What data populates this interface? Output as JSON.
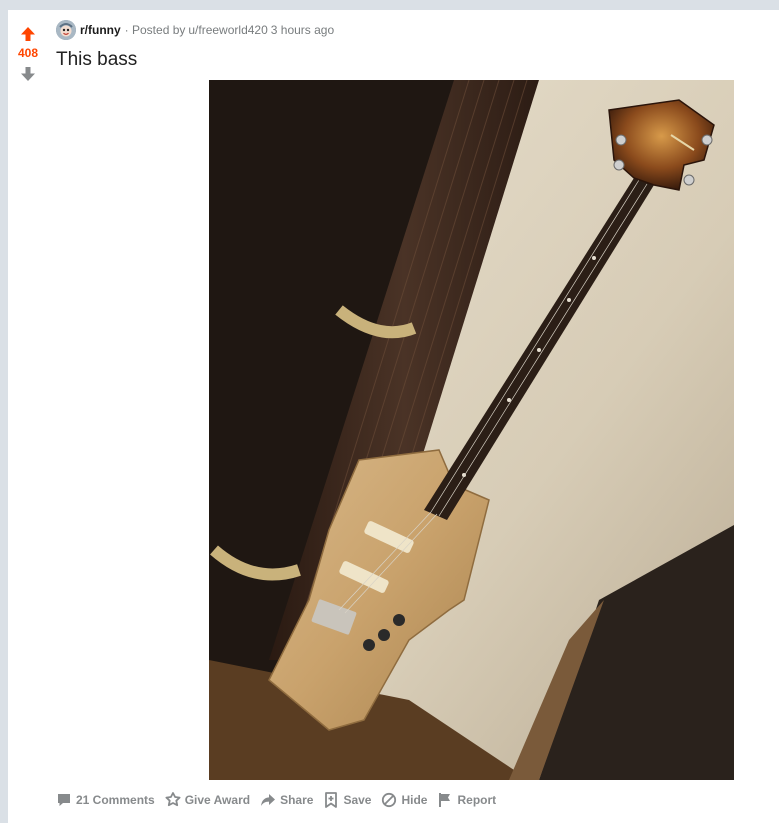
{
  "post": {
    "score": "408",
    "subreddit": "r/funny",
    "posted_by_prefix": "· Posted by",
    "author": "u/freeworld420",
    "time_ago": "3 hours ago",
    "title": "This bass"
  },
  "actions": {
    "comments": "21 Comments",
    "give_award": "Give Award",
    "share": "Share",
    "save": "Save",
    "hide": "Hide",
    "report": "Report"
  },
  "icons": {
    "upvote": "upvote-icon",
    "downvote": "downvote-icon",
    "comments": "comment-icon",
    "award": "award-icon",
    "share": "share-icon",
    "save": "bookmark-icon",
    "hide": "hide-icon",
    "report": "flag-icon"
  },
  "colors": {
    "upvote_active": "#ff4500",
    "downvote": "#878a8c",
    "muted": "#878a8c",
    "background": "#dae0e6"
  }
}
